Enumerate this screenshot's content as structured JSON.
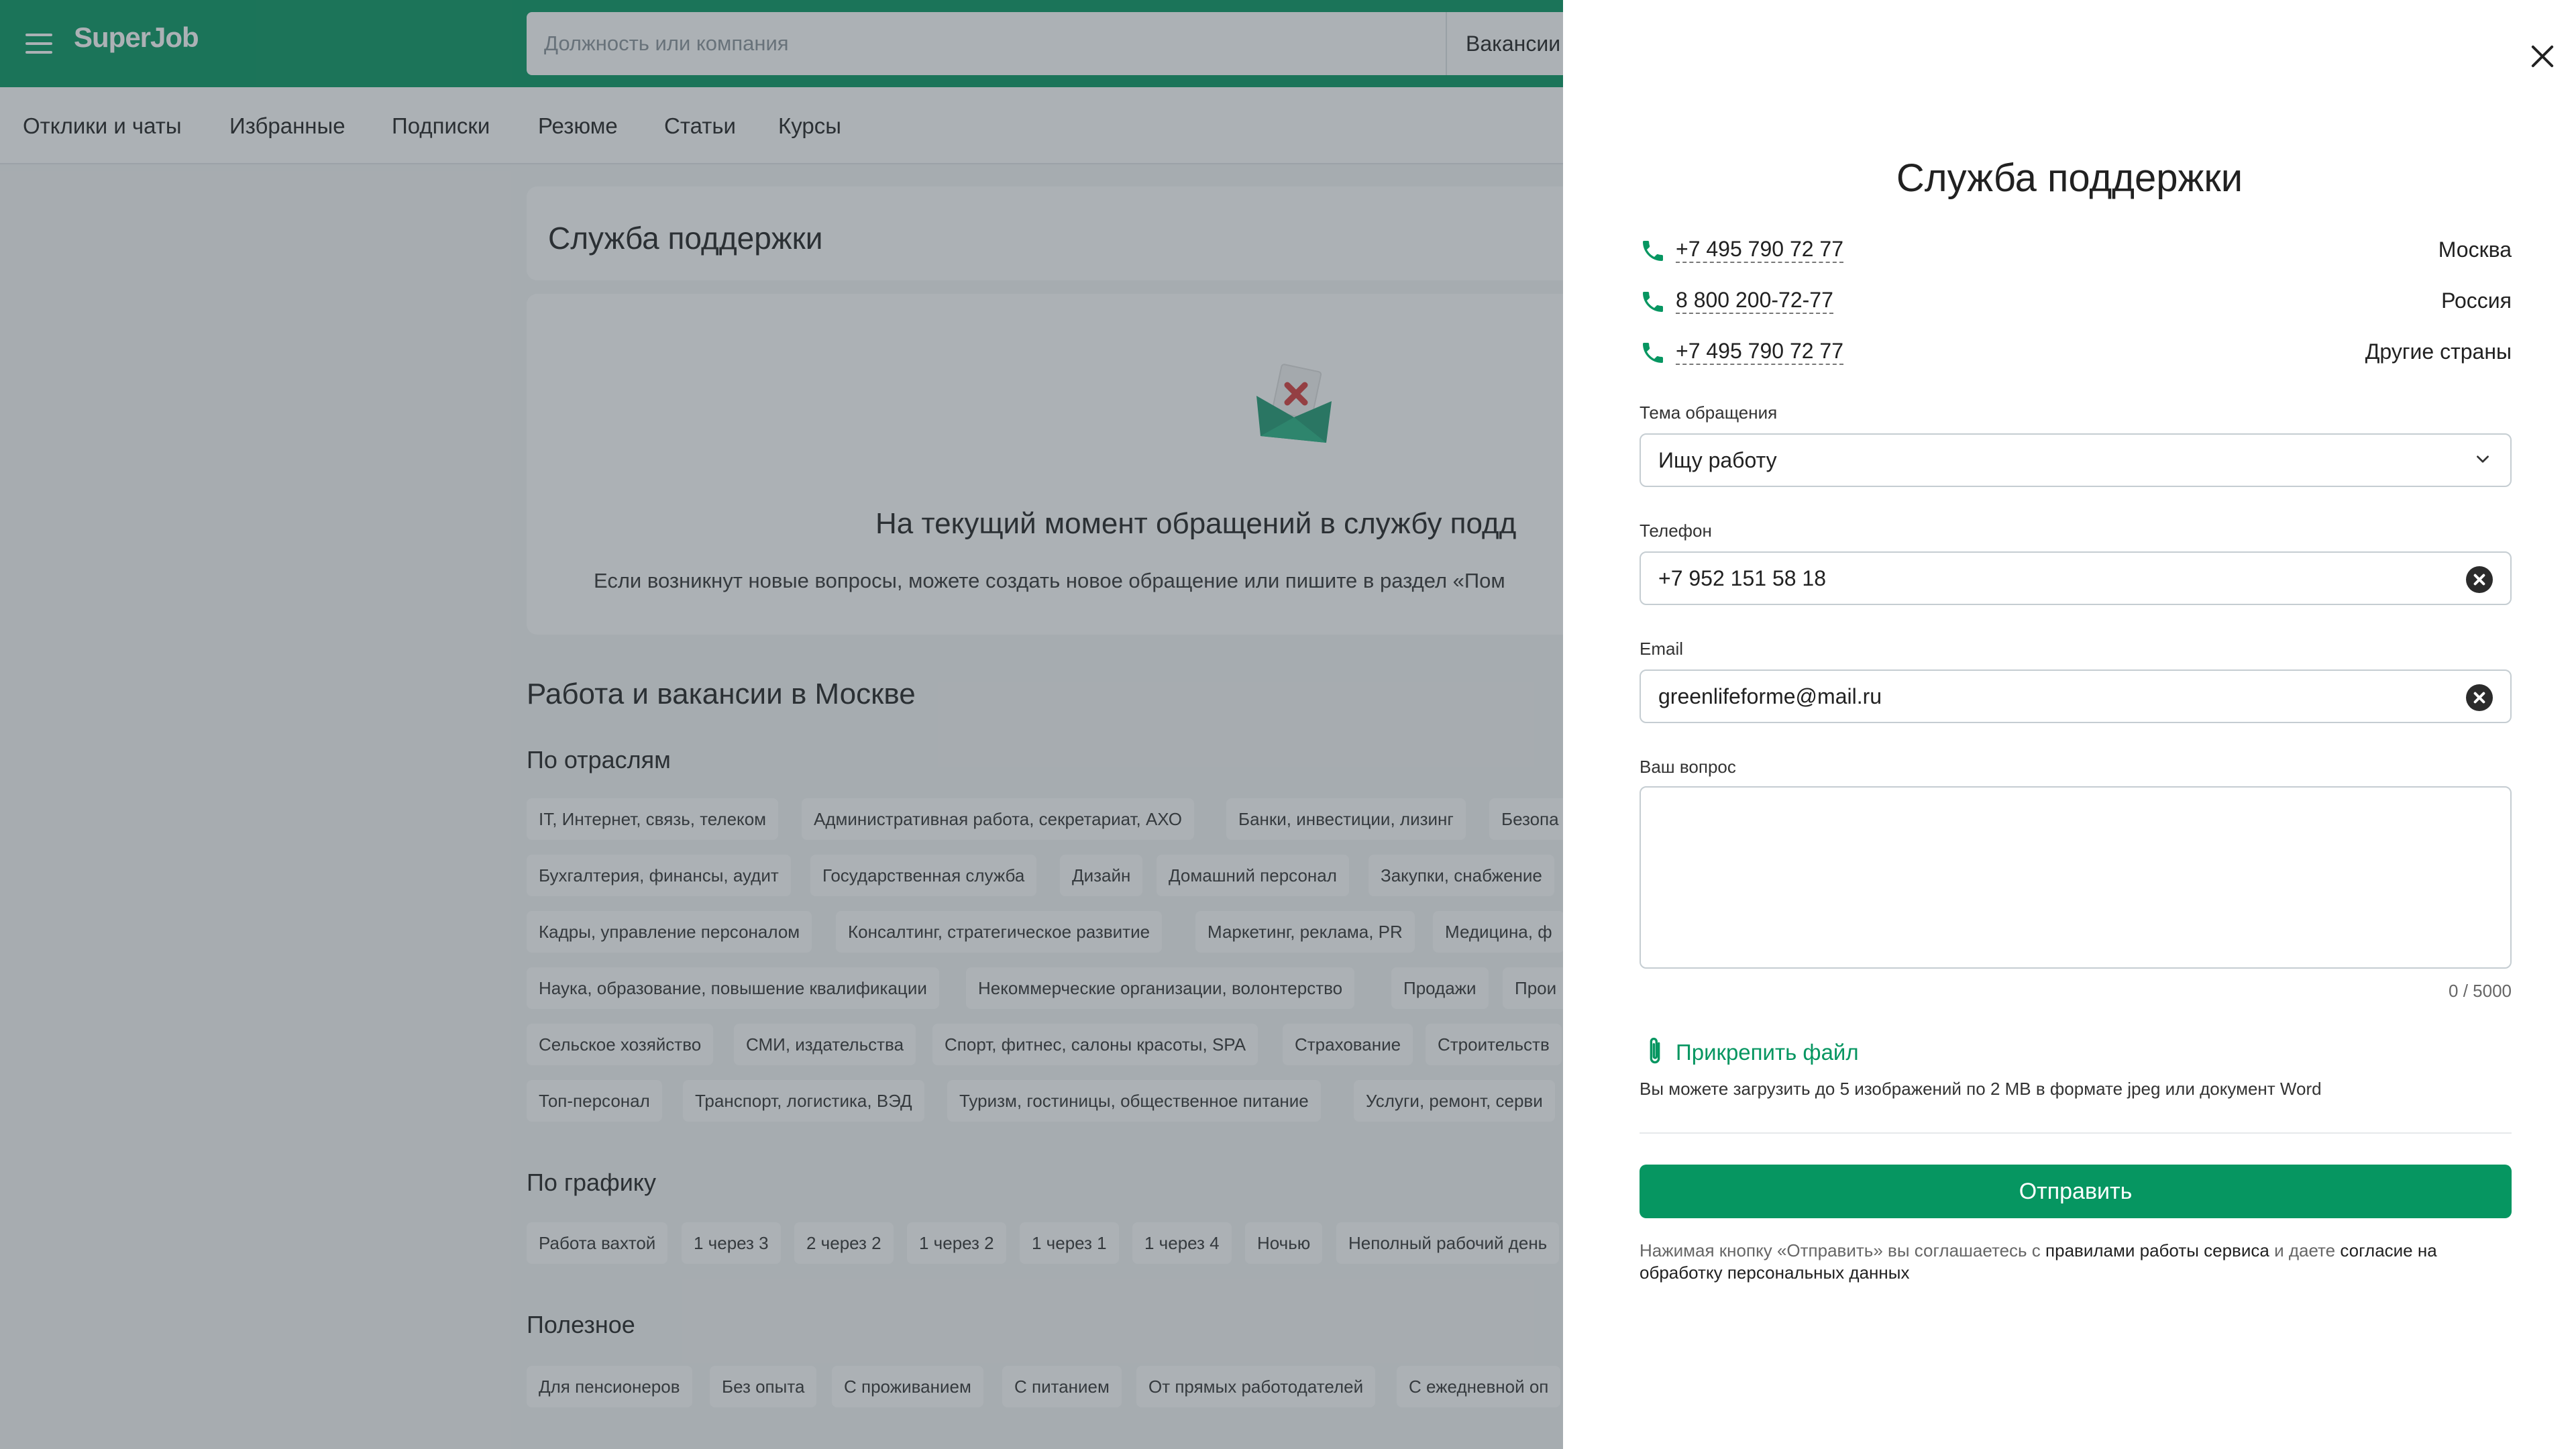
{
  "header": {
    "logo": "SuperJob",
    "search_placeholder": "Должность или компания",
    "search_category": "Вакансии"
  },
  "subnav": [
    "Отклики и чаты",
    "Избранные",
    "Подписки",
    "Резюме",
    "Статьи",
    "Курсы"
  ],
  "page": {
    "title": "Служба поддержки",
    "empty_title": "На текущий момент обращений в службу подд",
    "empty_subtitle": "Если возникнут новые вопросы, можете создать новое обращение или пишите в раздел «Пом"
  },
  "seo": {
    "title": "Работа и вакансии в Москве",
    "industries_title": "По отраслям",
    "industries": [
      [
        "IT, Интернет, связь, телеком",
        "Административная работа, секретариат, АХО",
        "Банки, инвестиции, лизинг",
        "Безопа"
      ],
      [
        "Бухгалтерия, финансы, аудит",
        "Государственная служба",
        "Дизайн",
        "Домашний персонал",
        "Закупки, снабжение"
      ],
      [
        "Кадры, управление персоналом",
        "Консалтинг, стратегическое развитие",
        "Маркетинг, реклама, PR",
        "Медицина, ф"
      ],
      [
        "Наука, образование, повышение квалификации",
        "Некоммерческие организации, волонтерство",
        "Продажи",
        "Прои"
      ],
      [
        "Сельское хозяйство",
        "СМИ, издательства",
        "Спорт, фитнес, салоны красоты, SPA",
        "Страхование",
        "Строительств"
      ],
      [
        "Топ-персонал",
        "Транспорт, логистика, ВЭД",
        "Туризм, гостиницы, общественное питание",
        "Услуги, ремонт, серви"
      ]
    ],
    "schedule_title": "По графику",
    "schedule": [
      "Работа вахтой",
      "1 через 3",
      "2 через 2",
      "1 через 2",
      "1 через 1",
      "1 через 4",
      "Ночью",
      "Неполный рабочий день"
    ],
    "useful_title": "Полезное",
    "useful": [
      "Для пенсионеров",
      "Без опыта",
      "С проживанием",
      "С питанием",
      "От прямых работодателей",
      "С ежедневной оп"
    ]
  },
  "modal": {
    "title": "Служба поддержки",
    "phones": [
      {
        "number": "+7 495 790 72 77",
        "region": "Москва"
      },
      {
        "number": "8 800 200-72-77",
        "region": "Россия"
      },
      {
        "number": "+7 495 790 72 77",
        "region": "Другие страны"
      }
    ],
    "topic_label": "Тема обращения",
    "topic_value": "Ищу работу",
    "phone_label": "Телефон",
    "phone_value": "+7 952 151 58 18",
    "email_label": "Email",
    "email_value": "greenlifeforme@mail.ru",
    "question_label": "Ваш вопрос",
    "question_value": "",
    "counter": "0 / 5000",
    "attach_label": "Прикрепить файл",
    "attach_hint": "Вы можете загрузить до 5 изображений по 2 MB в формате jpeg или документ Word",
    "submit_label": "Отправить",
    "terms_prefix": "Нажимая кнопку «Отправить» вы соглашаетесь с ",
    "terms_link1": "правилами работы сервиса",
    "terms_mid": " и даете ",
    "terms_link2": "согласие на обработку персональных данных"
  },
  "colors": {
    "brand": "#069661",
    "text": "#212121",
    "muted": "#666666"
  }
}
